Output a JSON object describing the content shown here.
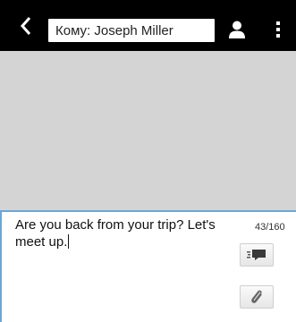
{
  "header": {
    "recipient_field": "Кому: Joseph Miller",
    "back_icon": "chevron-left-icon",
    "contact_icon": "person-icon",
    "menu_icon": "overflow-menu-icon"
  },
  "composer": {
    "message_text": "Are you back from your trip? Let's meet up.",
    "char_count": "43/160",
    "send_icon": "send-icon",
    "attach_icon": "paperclip-icon"
  },
  "colors": {
    "header_bg": "#000000",
    "thread_bg": "#d4d4d4",
    "composer_border": "#6aa7d9"
  }
}
